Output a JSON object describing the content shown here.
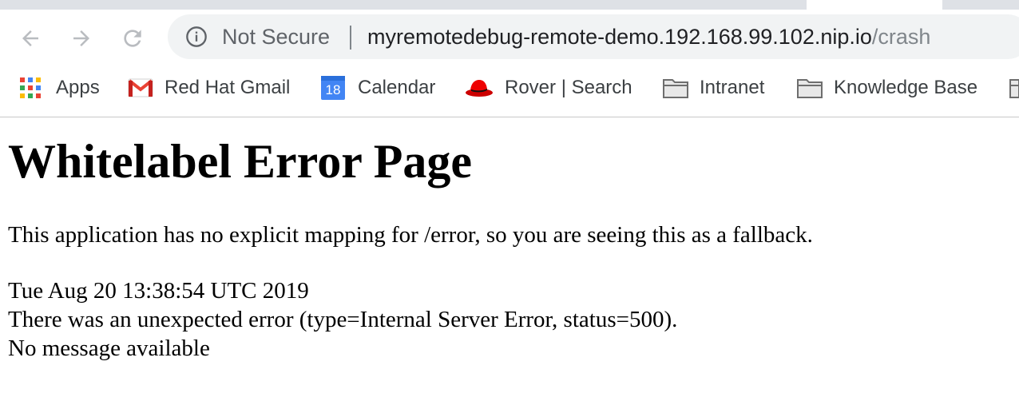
{
  "browser": {
    "security_label": "Not Secure",
    "url_host": "myremotedebug-remote-demo.192.168.99.102.nip.io",
    "url_path": "/crash",
    "nav_icons": [
      "back-icon",
      "forward-icon",
      "reload-icon"
    ]
  },
  "bookmarks": {
    "items": [
      {
        "label": "Apps",
        "icon": "apps-grid-icon"
      },
      {
        "label": "Red Hat Gmail",
        "icon": "gmail-icon"
      },
      {
        "label": "Calendar",
        "icon": "calendar-icon",
        "icon_text": "18"
      },
      {
        "label": "Rover | Search",
        "icon": "red-hat-icon"
      },
      {
        "label": "Intranet",
        "icon": "folder-icon"
      },
      {
        "label": "Knowledge Base",
        "icon": "folder-icon"
      }
    ]
  },
  "page": {
    "title": "Whitelabel Error Page",
    "description": "This application has no explicit mapping for /error, so you are seeing this as a fallback.",
    "timestamp": "Tue Aug 20 13:38:54 UTC 2019",
    "error_line": "There was an unexpected error (type=Internal Server Error, status=500).",
    "message": "No message available"
  },
  "colors": {
    "gmail_red": "#ea4335",
    "calendar_blue": "#4285f4",
    "redhat_red": "#ee0000"
  }
}
